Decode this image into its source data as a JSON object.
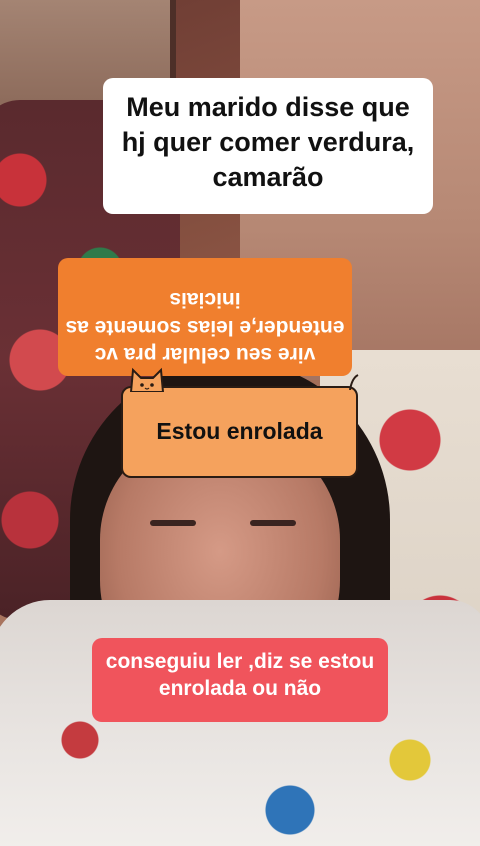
{
  "captions": {
    "top": "Meu marido disse que hj quer comer verdura, camarão",
    "flipped": "vire seu celular pra vc entender,e leias somente as iniciais",
    "cat_box": "Estou enrolada",
    "bottom": "conseguiu ler ,diz se estou enrolada ou não"
  },
  "colors": {
    "top_caption_bg": "#ffffff",
    "flipped_caption_bg": "#f07f2e",
    "cat_box_bg": "#f5a25d",
    "bottom_caption_bg": "#f0545c"
  },
  "icons": {
    "cat_sticker": "cat-ears-icon"
  }
}
